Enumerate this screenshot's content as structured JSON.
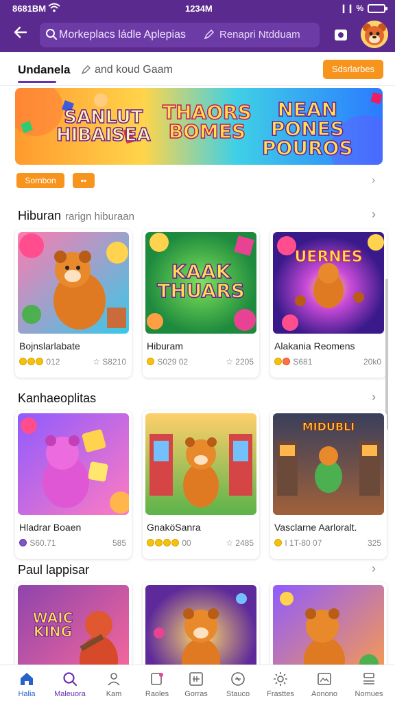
{
  "status_bar": {
    "left": "8681BM",
    "time": "1234M",
    "signal": "❙❙ %"
  },
  "header": {
    "search_text": "Morkeplacs ládle Aplepias",
    "search_text_2": "Renapri Ntdduam"
  },
  "tabs": {
    "active": "Undanela",
    "second": "and koud Gaam",
    "action_button": "Sdsrlarbes"
  },
  "banner": {
    "titles": [
      "SANLUT\nHIBAISEA",
      "THAORS\nBOMES",
      "NEAN\nPONES\nPOUROS"
    ]
  },
  "chips": {
    "first": "Sornbon",
    "second": "▪▪"
  },
  "sections": [
    {
      "title": "Hiburan",
      "subtitle": "rarign hiburaan",
      "cards": [
        {
          "title": "Bojnslarlabate",
          "meta_left": "012",
          "meta_right": "☆ S8210",
          "thumb_text": ""
        },
        {
          "title": "Hiburam",
          "meta_left": "S029 02",
          "meta_right": "☆ 2205",
          "thumb_text": "KAAK\nTHUARS"
        },
        {
          "title": "Alakania Reomens",
          "meta_left": "S681",
          "meta_right": "20k0",
          "thumb_text": "UERNES"
        }
      ]
    },
    {
      "title": "Kanhaeoplitas",
      "subtitle": "",
      "cards": [
        {
          "title": "Hladrar Boaen",
          "meta_left": "S60.71",
          "meta_right": "585",
          "thumb_text": ""
        },
        {
          "title": "GnaköSanra",
          "meta_left": "00",
          "meta_right": "☆ 2485",
          "thumb_text": ""
        },
        {
          "title": "Vasclarne Aarloralt.",
          "meta_left": "I 1T-80 07",
          "meta_right": "325",
          "thumb_text": "MIDUBLI"
        }
      ]
    },
    {
      "title": "Paul lappisar",
      "subtitle": "",
      "cards": [
        {
          "title": "",
          "meta_left": "",
          "meta_right": "",
          "thumb_text": "WAIC\nKING"
        },
        {
          "title": "",
          "meta_left": "",
          "meta_right": "",
          "thumb_text": ""
        },
        {
          "title": "",
          "meta_left": "",
          "meta_right": "",
          "thumb_text": ""
        }
      ]
    }
  ],
  "bottom_nav": [
    {
      "label": "Halia",
      "icon": "home-icon"
    },
    {
      "label": "Maleuora",
      "icon": "search-icon"
    },
    {
      "label": "Kam",
      "icon": "user-icon"
    },
    {
      "label": "Raoles",
      "icon": "tag-icon"
    },
    {
      "label": "Gorras",
      "icon": "grid-icon"
    },
    {
      "label": "Stauco",
      "icon": "chat-icon"
    },
    {
      "label": "Frasttes",
      "icon": "gear-icon"
    },
    {
      "label": "Aonono",
      "icon": "image-icon"
    },
    {
      "label": "Nomues",
      "icon": "menu-icon"
    }
  ],
  "colors": {
    "brand_purple": "#5b2a8f",
    "accent_orange": "#f7941d",
    "active_blue": "#2563c9"
  }
}
